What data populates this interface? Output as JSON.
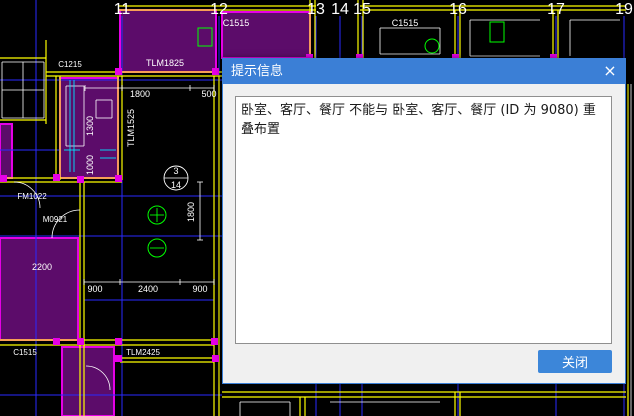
{
  "cad": {
    "axis_labels": [
      "11",
      "12",
      "13",
      "14",
      "15",
      "16",
      "17",
      "19"
    ],
    "labels": {
      "c1515_a": "C1515",
      "c1515_b": "C1515",
      "c1215": "C1215",
      "tlm1825": "TLM1825",
      "dim_1800_top": "1800",
      "dim_500": "500",
      "tlm1525": "TLM1525",
      "dim_1300": "1300",
      "dim_1000": "1000",
      "bubble_3": "3",
      "bubble_14": "14",
      "fm1022": "FM1022",
      "m0921": "M0921",
      "dim_1800_v": "1800",
      "dim_2200": "2200",
      "dim_900_l": "900",
      "dim_2400": "2400",
      "dim_900_r": "900",
      "c1515_c": "C1515",
      "tlm2425": "TLM2425"
    }
  },
  "dialog": {
    "title": "提示信息",
    "close_icon": "close-icon",
    "close_glyph": "×",
    "message": "卧室、客厅、餐厅 不能与 卧室、客厅、餐厅 (ID 为 9080) 重叠布置",
    "close_button_label": "关闭"
  },
  "colors": {
    "cad_background": "#000000",
    "room_fill": "#5c0c6a",
    "room_border": "#e600e6",
    "wall": "#ffff00",
    "axis": "#2a2aff",
    "column": "#e600e6",
    "dimension": "#ffffff",
    "symbol": "#00ff00",
    "stair": "#00e5ff",
    "dialog_title_bar": "#3b7fd6",
    "button": "#3c86d9"
  }
}
